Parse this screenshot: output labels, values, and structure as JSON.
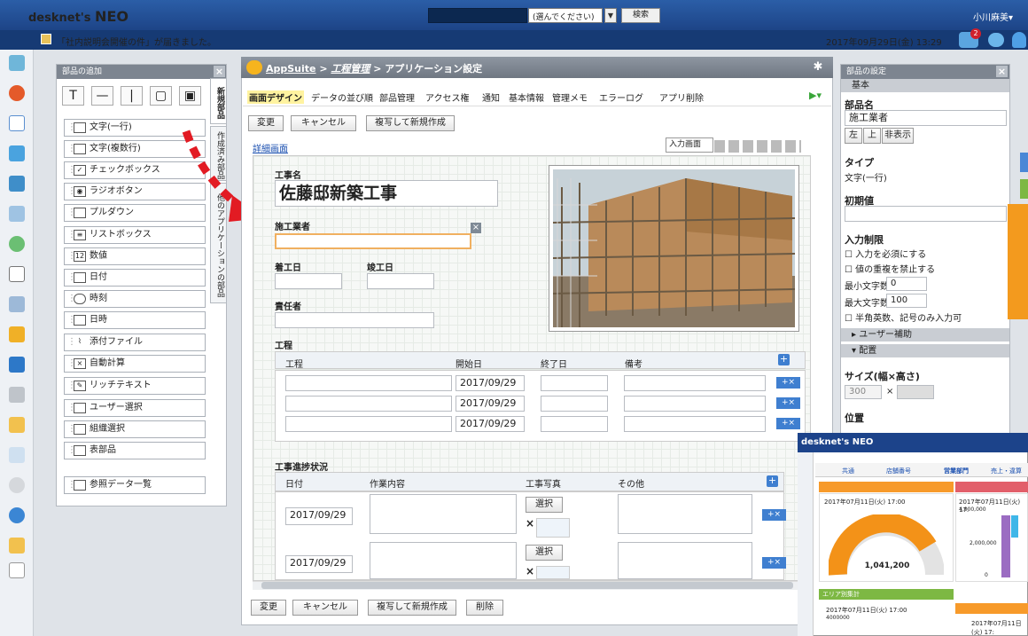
{
  "header": {
    "logo": "desknet's",
    "logo_neo": "NEO",
    "search_select": "(選んでください)",
    "search_button": "検索",
    "user": "小川麻美"
  },
  "notification": {
    "text": "「社内説明会開催の件」が届きました。",
    "datetime": "2017年09月29日(金) 13:29",
    "badge_count": "2"
  },
  "parts_panel": {
    "title": "部品の追加",
    "tabs": [
      "新規部品",
      "作成済み部品",
      "他のアプリケーションの部品"
    ],
    "items": [
      "文字(一行)",
      "文字(複数行)",
      "チェックボックス",
      "ラジオボタン",
      "プルダウン",
      "リストボックス",
      "数値",
      "日付",
      "時刻",
      "日時",
      "添付ファイル",
      "自動計算",
      "リッチテキスト",
      "ユーザー選択",
      "組織選択",
      "表部品",
      "参照データ一覧"
    ]
  },
  "main": {
    "app_name": "AppSuite",
    "breadcrumb_sep1": " > ",
    "app_link": "工程管理",
    "breadcrumb_sep2": " > ",
    "page": "アプリケーション設定",
    "tabs": [
      "画面デザイン",
      "データの並び順",
      "部品管理",
      "アクセス権",
      "通知",
      "基本情報",
      "管理メモ",
      "エラーログ",
      "アプリ削除"
    ],
    "btn_change": "変更",
    "btn_cancel": "キャンセル",
    "btn_copy": "複写して新規作成",
    "btn_delete": "削除",
    "detail_link": "詳細画面",
    "input_screen": "入力画面",
    "form": {
      "koji_label": "工事名",
      "koji_value": "佐藤邸新築工事",
      "shiko_label": "施工業者",
      "chakko_label": "着工日",
      "shunko_label": "竣工日",
      "sekinin_label": "責任者",
      "kotei_title": "工程",
      "kotei_headers": [
        "工程",
        "開始日",
        "終了日",
        "備考"
      ],
      "kotei_rows": [
        "2017/09/29",
        "2017/09/29",
        "2017/09/29"
      ],
      "progress_title": "工事進捗状況",
      "progress_headers": [
        "日付",
        "作業内容",
        "工事写真",
        "その他"
      ],
      "progress_rows": [
        "2017/09/29",
        "2017/09/29"
      ],
      "select": "選択"
    }
  },
  "settings": {
    "title": "部品の設定",
    "basic": "基本",
    "name_label": "部品名",
    "name_value": "施工業者",
    "align": [
      "左",
      "上",
      "非表示"
    ],
    "type_label": "タイプ",
    "type_value": "文字(一行)",
    "initial_label": "初期値",
    "input_limit": "入力制限",
    "check1": "入力を必須にする",
    "check2": "値の重複を禁止する",
    "min_label": "最小文字数",
    "min_value": "0",
    "max_label": "最大文字数",
    "max_value": "100",
    "check3": "半角英数、記号のみ入力可",
    "user_assist": "ユーザー補助",
    "layout": "配置",
    "size_label": "サイズ(幅×高さ)",
    "width": "300",
    "position_label": "位置",
    "pos_x": "40",
    "pos_y": "120"
  },
  "overlay": {
    "logo": "desknet's NEO",
    "tabs": [
      "共通",
      "店舗番号",
      "営業部門",
      "売上・違算"
    ],
    "card1_time": "2017年07月11日(火) 17:00",
    "card2_time": "2017年07月11日(火) 17:",
    "gauge_value": "1,041,200",
    "axis_4m": "4,000,000",
    "axis_2m": "2,000,000",
    "axis_0": "0",
    "card3_time": "2017年07月11日(火) 17:00",
    "card3_val": "4000000",
    "card4_time": "2017年07月11日(火) 17:",
    "label_area": "エリア別集計"
  }
}
